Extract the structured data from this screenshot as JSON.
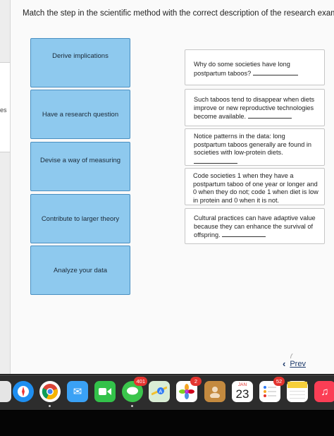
{
  "left_panel": {
    "cut_text": "es"
  },
  "question": {
    "instruction": "Match the step in the scientific method with the correct description of the research example."
  },
  "steps": [
    {
      "label": "Derive implications"
    },
    {
      "label": "Have a research question"
    },
    {
      "label": "Devise a way of measuring"
    },
    {
      "label": "Contribute to larger theory"
    },
    {
      "label": "Analyze your data"
    }
  ],
  "descriptions": [
    {
      "text": "Why do some societies have long postpartum taboos?"
    },
    {
      "text": "Such taboos tend to disappear when diets improve or new reproductive technologies become available."
    },
    {
      "text": "Notice patterns in the data: long postpartum taboos generally are found in societies with low-protein diets."
    },
    {
      "text": "Code societies 1 when they have a postpartum taboo of one year or longer and 0 when they do not; code 1 when diet is low in protein and 0 when it is not."
    },
    {
      "text": "Cultural practices can have adaptive value because they can enhance the survival of offspring."
    }
  ],
  "nav": {
    "prev_label": "Prev",
    "prev_icon": "chevron-left-icon"
  },
  "dock": {
    "messages_badge": "401",
    "photos_badge": "2",
    "calendar_month": "JAN",
    "calendar_day": "23",
    "reminders_badge": "52"
  },
  "colors": {
    "step_fill": "#8ec9ee",
    "step_border": "#4a8fc1",
    "nav_text": "#1d3a6b",
    "badge": "#e3342f"
  }
}
